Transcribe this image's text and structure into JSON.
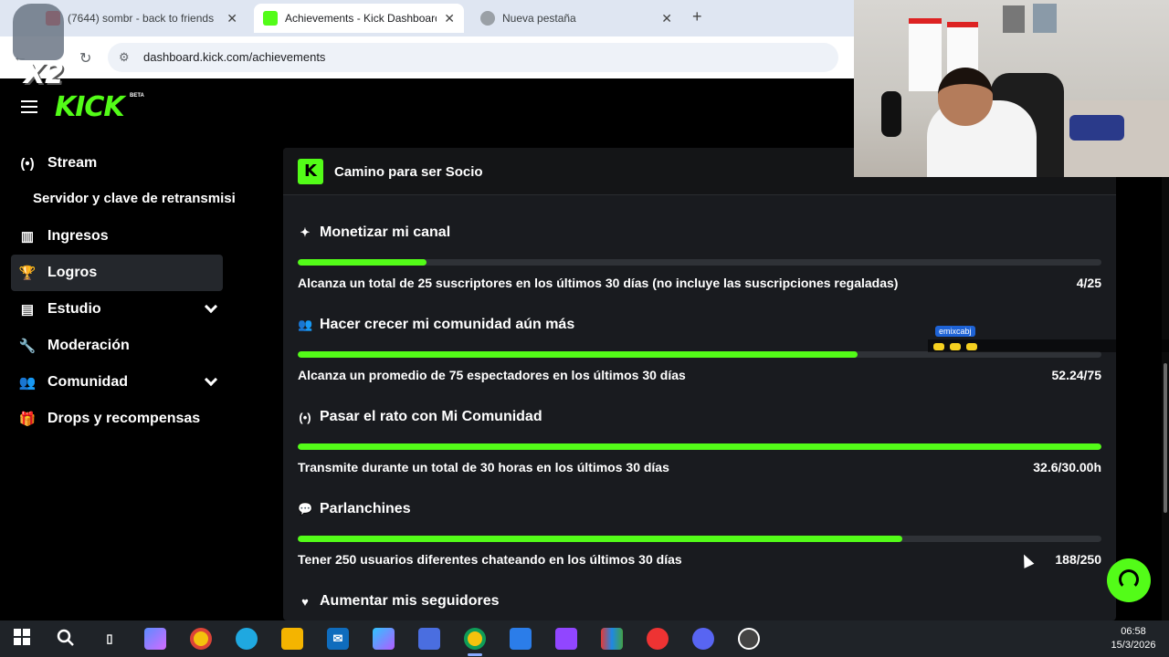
{
  "browser": {
    "tabs": [
      {
        "label": "(7644) sombr - back to friends",
        "favicon_color": "#ff0000",
        "active": false
      },
      {
        "label": "Achievements - Kick Dashboard",
        "favicon_color": "#53fc18",
        "active": true
      },
      {
        "label": "Nueva pestaña",
        "favicon_color": "#9aa0a6",
        "active": false
      }
    ],
    "new_tab": "+",
    "close": "✕",
    "url": "dashboard.kick.com/achievements"
  },
  "brand": {
    "logo": "KICK",
    "badge": "BETA",
    "accent": "#53fc18"
  },
  "sidebar": {
    "items": [
      {
        "label": "Stream",
        "icon": "broadcast-icon",
        "glyph": "(•)"
      },
      {
        "label": "Ingresos",
        "icon": "chart-icon",
        "glyph": "▥"
      },
      {
        "label": "Logros",
        "icon": "trophy-icon",
        "glyph": "🏆"
      },
      {
        "label": "Estudio",
        "icon": "studio-icon",
        "glyph": "▤"
      },
      {
        "label": "Moderación",
        "icon": "wrench-icon",
        "glyph": "🔧"
      },
      {
        "label": "Comunidad",
        "icon": "users-icon",
        "glyph": "👥"
      },
      {
        "label": "Drops y recompensas",
        "icon": "gift-icon",
        "glyph": "🎁"
      }
    ],
    "sub_item": "Servidor y clave de retransmisión",
    "active": "Logros"
  },
  "panel": {
    "title": "Camino para ser Socio",
    "badge": "K",
    "goals": [
      {
        "title": "Monetizar mi canal",
        "icon": "sparkle-icon",
        "glyph": "✦",
        "description": "Alcanza un total de 25 suscriptores en los últimos 30 días (no incluye las suscripciones regaladas)",
        "count": "4/25",
        "progress": 0.16
      },
      {
        "title": "Hacer crecer mi comunidad aún más",
        "icon": "community-icon",
        "glyph": "👥",
        "description": "Alcanza un promedio de 75 espectadores en los últimos 30 días",
        "count": "52.24/75",
        "progress": 0.6965
      },
      {
        "title": "Pasar el rato con Mi Comunidad",
        "icon": "broadcast-icon",
        "glyph": "(•)",
        "description": "Transmite durante un total de 30 horas en los últimos 30 días",
        "count": "32.6/30.00h",
        "progress": 1.0
      },
      {
        "title": "Parlanchines",
        "icon": "chat-icon",
        "glyph": "💬",
        "description": "Tener 250 usuarios diferentes chateando en los últimos 30 días",
        "count": "188/250",
        "progress": 0.752
      },
      {
        "title": "Aumentar mis seguidores",
        "icon": "heart-icon",
        "glyph": "♥",
        "description": "",
        "count": "",
        "progress": null
      }
    ]
  },
  "overlay": {
    "x2": "X2",
    "chat_user": "emixcabj"
  },
  "taskbar": {
    "time": "06:58",
    "date": "15/3/2026"
  }
}
